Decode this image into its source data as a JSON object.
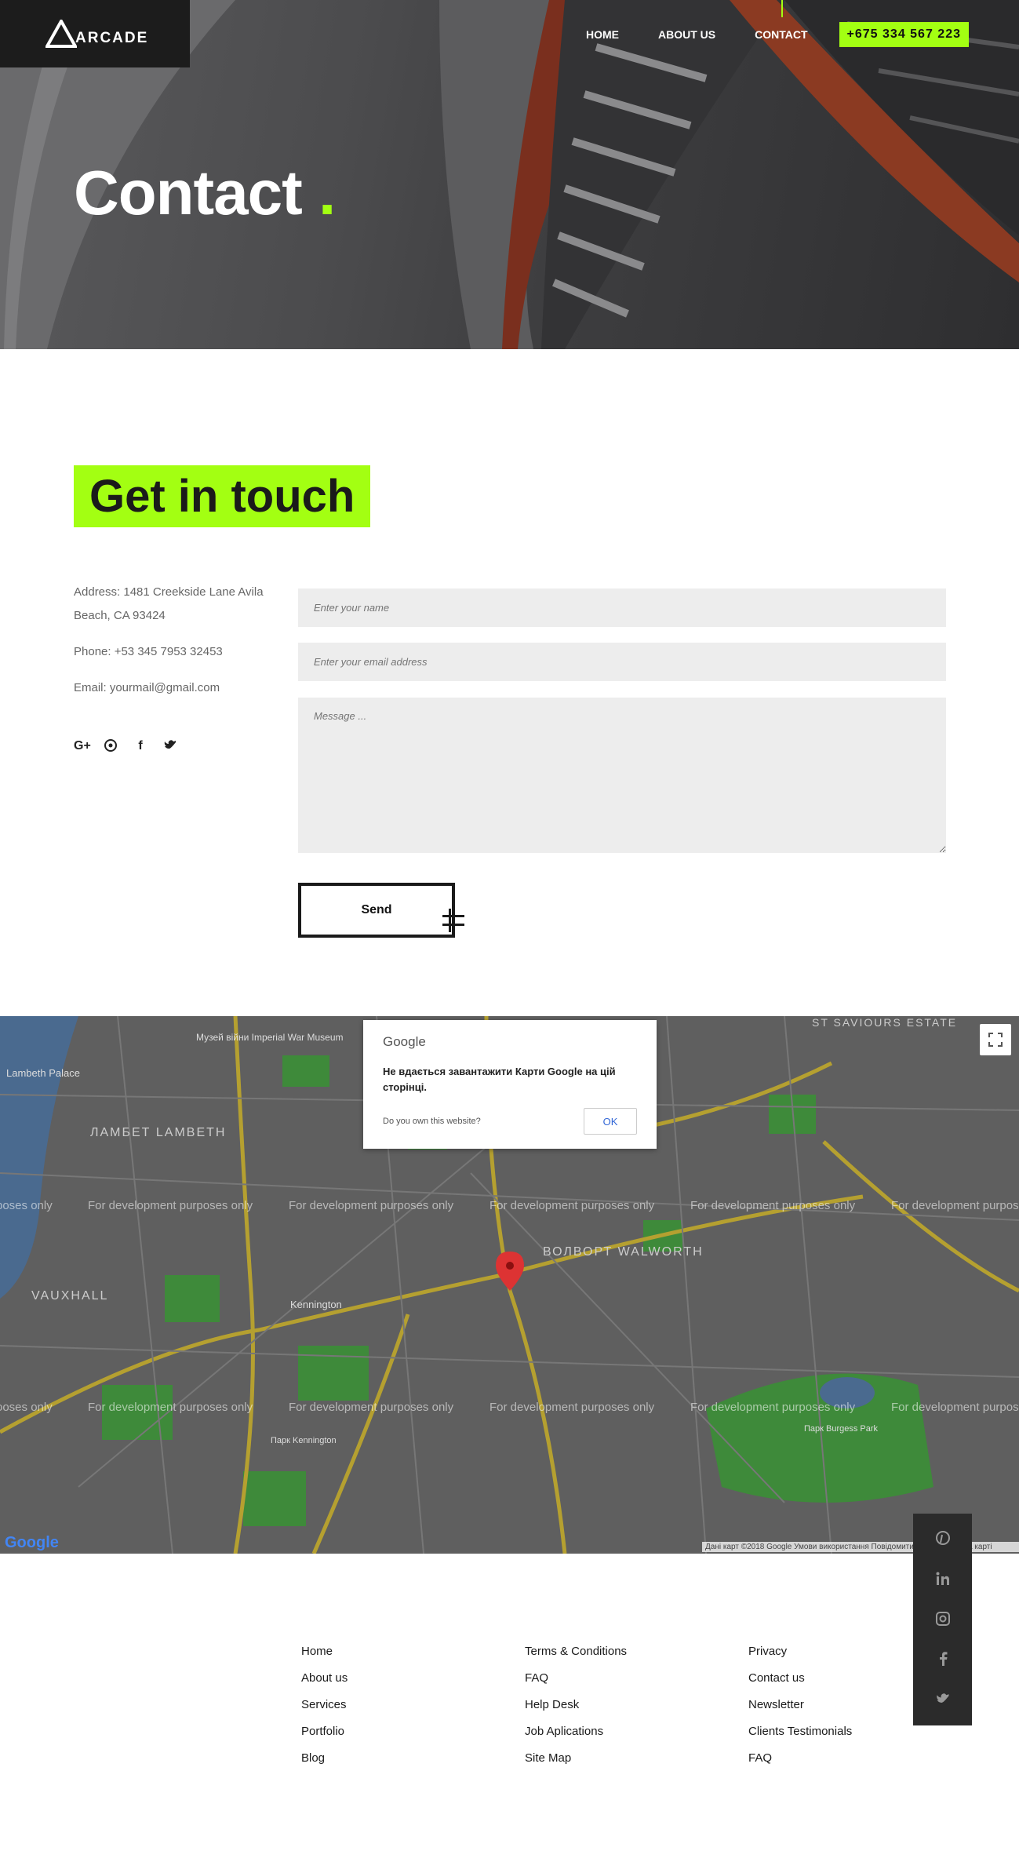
{
  "header": {
    "logo_text": "ARCADE",
    "nav": [
      "HOME",
      "ABOUT US",
      "CONTACT"
    ],
    "phone": "+675 334 567 223"
  },
  "hero": {
    "title": "Contact",
    "dot": "."
  },
  "touch": {
    "title": "Get in touch",
    "address": "Address: 1481 Creekside Lane Avila Beach, CA 93424",
    "phone": "Phone: +53 345 7953 32453",
    "email": "Email: yourmail@gmail.com",
    "socials": [
      "G+",
      "p",
      "f",
      "t"
    ]
  },
  "form": {
    "name_placeholder": "Enter your name",
    "email_placeholder": "Enter your email address",
    "message_placeholder": "Message ...",
    "send_label": "Send"
  },
  "map": {
    "dialog_logo": "Google",
    "dialog_message": "Не вдається завантажити Карти Google на цій сторінці.",
    "dialog_own": "Do you own this website?",
    "dialog_ok": "OK",
    "dev_text": "For development purposes only",
    "dev_text_edge": "poses only",
    "dev_text_edge2": "ooses only",
    "watermark": "Google",
    "attribution": "Дані карт ©2018 Google   Умови використання   Повідомити про помилку на карті",
    "labels": [
      "ЛАМБЕТ LAMBETH",
      "ВОЛВОРТ WALWORTH",
      "VAUXHALL",
      "Kennington",
      "Lambeth Palace",
      "Музей війни Imperial War Museum",
      "Парк Kennington",
      "Парк Burgess Park",
      "ST SAVIOURS ESTATE"
    ]
  },
  "side_social": [
    "pinterest-icon",
    "linkedin-icon",
    "instagram-icon",
    "facebook-icon",
    "twitter-icon"
  ],
  "footer": {
    "col1": [
      "Home",
      "About us",
      "Services",
      "Portfolio",
      "Blog"
    ],
    "col2": [
      "Terms & Conditions",
      "FAQ",
      "Help Desk",
      "Job Aplications",
      "Site Map"
    ],
    "col3": [
      "Privacy",
      "Contact us",
      "Newsletter",
      "Clients Testimonials",
      "FAQ"
    ]
  },
  "colors": {
    "accent": "#a3ff12",
    "dark": "#1c1c1c"
  }
}
